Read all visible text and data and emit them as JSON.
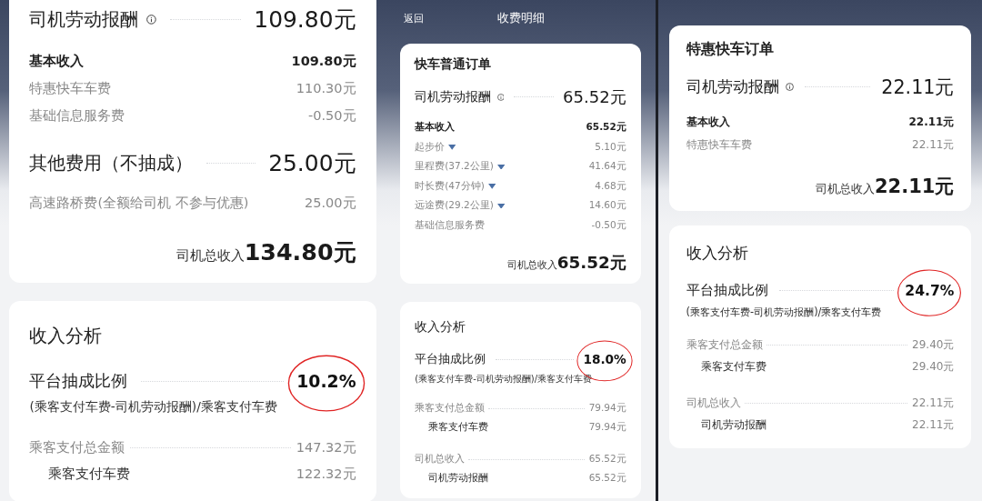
{
  "panels": [
    {
      "labor": {
        "label": "司机劳动报酬",
        "amount": "109.80元"
      },
      "items": [
        {
          "kind": "heading",
          "label": "基本收入",
          "amount": "109.80元"
        },
        {
          "kind": "item",
          "label": "特惠快车车费",
          "amount": "110.30元"
        },
        {
          "kind": "item",
          "label": "基础信息服务费",
          "amount": "-0.50元"
        }
      ],
      "other_fees": {
        "label": "其他费用（不抽成）",
        "amount": "25.00元",
        "items": [
          {
            "label": "高速路桥费(全额给司机 不参与优惠)",
            "amount": "25.00元"
          }
        ]
      },
      "total": {
        "label": "司机总收入",
        "amount": "134.80元"
      },
      "analysis": {
        "title": "收入分析",
        "ratio_label": "平台抽成比例",
        "ratio": "10.2%",
        "circled": true,
        "formula": "(乘客支付车费-司机劳动报酬)/乘客支付车费",
        "rows": [
          {
            "kind": "group",
            "label": "乘客支付总金额",
            "amount": "147.32元"
          },
          {
            "kind": "sub",
            "label": "乘客支付车费",
            "amount": "122.32元"
          }
        ]
      }
    },
    {
      "header": {
        "back": "返回",
        "title": "收费明细"
      },
      "order_type": "快车普通订单",
      "labor": {
        "label": "司机劳动报酬",
        "amount": "65.52元"
      },
      "items": [
        {
          "kind": "heading",
          "label": "基本收入",
          "amount": "65.52元",
          "expandable": false
        },
        {
          "kind": "item",
          "label": "起步价",
          "amount": "5.10元",
          "expandable": true
        },
        {
          "kind": "item",
          "label": "里程费(37.2公里)",
          "amount": "41.64元",
          "expandable": true
        },
        {
          "kind": "item",
          "label": "时长费(47分钟)",
          "amount": "4.68元",
          "expandable": true
        },
        {
          "kind": "item",
          "label": "远途费(29.2公里)",
          "amount": "14.60元",
          "expandable": true
        },
        {
          "kind": "item",
          "label": "基础信息服务费",
          "amount": "-0.50元",
          "expandable": false
        }
      ],
      "total": {
        "label": "司机总收入",
        "amount": "65.52元"
      },
      "analysis": {
        "title": "收入分析",
        "ratio_label": "平台抽成比例",
        "ratio": "18.0%",
        "circled": true,
        "formula": "(乘客支付车费-司机劳动报酬)/乘客支付车费",
        "rows": [
          {
            "kind": "group",
            "label": "乘客支付总金额",
            "amount": "79.94元"
          },
          {
            "kind": "sub",
            "label": "乘客支付车费",
            "amount": "79.94元"
          },
          {
            "kind": "group",
            "label": "司机总收入",
            "amount": "65.52元"
          },
          {
            "kind": "sub",
            "label": "司机劳动报酬",
            "amount": "65.52元"
          }
        ]
      }
    },
    {
      "order_type": "特惠快车订单",
      "labor": {
        "label": "司机劳动报酬",
        "amount": "22.11元"
      },
      "items": [
        {
          "kind": "heading",
          "label": "基本收入",
          "amount": "22.11元"
        },
        {
          "kind": "item",
          "label": "特惠快车车费",
          "amount": "22.11元"
        }
      ],
      "total": {
        "label": "司机总收入",
        "amount": "22.11元"
      },
      "analysis": {
        "title": "收入分析",
        "ratio_label": "平台抽成比例",
        "ratio": "24.7%",
        "circled": true,
        "formula": "(乘客支付车费-司机劳动报酬)/乘客支付车费",
        "rows": [
          {
            "kind": "group",
            "label": "乘客支付总金额",
            "amount": "29.40元"
          },
          {
            "kind": "sub",
            "label": "乘客支付车费",
            "amount": "29.40元"
          },
          {
            "kind": "group",
            "label": "司机总收入",
            "amount": "22.11元"
          },
          {
            "kind": "sub",
            "label": "司机劳动报酬",
            "amount": "22.11元"
          }
        ]
      }
    }
  ]
}
